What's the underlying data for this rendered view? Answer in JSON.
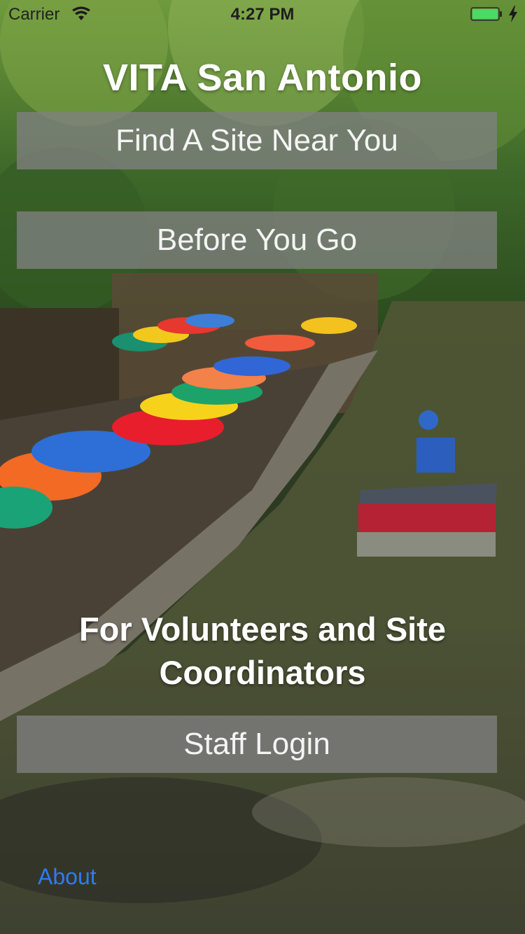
{
  "status_bar": {
    "carrier": "Carrier",
    "time": "4:27 PM"
  },
  "title": "VITA San Antonio",
  "buttons": {
    "find_site": "Find A Site Near You",
    "before_you_go": "Before You Go",
    "staff_login": "Staff Login"
  },
  "volunteer_section": {
    "heading": "For Volunteers and Site Coordinators"
  },
  "footer": {
    "about": "About"
  },
  "colors": {
    "button_bg": "#808080",
    "link": "#2f7bf0",
    "battery": "#4cd964"
  }
}
